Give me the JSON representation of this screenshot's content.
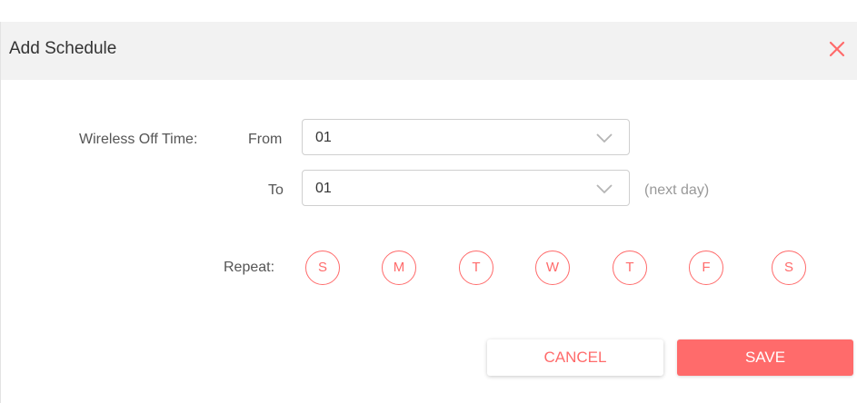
{
  "dialog": {
    "title": "Add Schedule",
    "close_icon": "close-icon"
  },
  "form": {
    "section_label": "Wireless Off Time:",
    "from_label": "From",
    "from_value": "01",
    "to_label": "To",
    "to_value": "01",
    "to_hint": "(next day)",
    "repeat_label": "Repeat:",
    "days": [
      "S",
      "M",
      "T",
      "W",
      "T",
      "F",
      "S"
    ]
  },
  "actions": {
    "cancel_label": "CANCEL",
    "save_label": "SAVE"
  },
  "colors": {
    "accent": "#ff6b6b",
    "header_bg": "#f2f2f2"
  }
}
